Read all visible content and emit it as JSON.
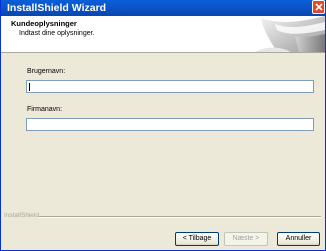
{
  "window": {
    "title": "InstallShield Wizard"
  },
  "header": {
    "title": "Kundeoplysninger",
    "subtitle": "Indtast dine oplysninger."
  },
  "form": {
    "username_label": "Brugernavn:",
    "username_value": "",
    "company_label": "Firmanavn:",
    "company_value": ""
  },
  "footer": {
    "brand": "InstallShield"
  },
  "buttons": {
    "back": "< Tilbage",
    "next": "Næste >",
    "cancel": "Annuller"
  },
  "icons": {
    "close": "close-icon",
    "header_graphic": "computer-graphic-icon"
  },
  "colors": {
    "titlebar": "#0a5fd8",
    "close": "#e2482b",
    "dialog_bg": "#ece9d8"
  }
}
